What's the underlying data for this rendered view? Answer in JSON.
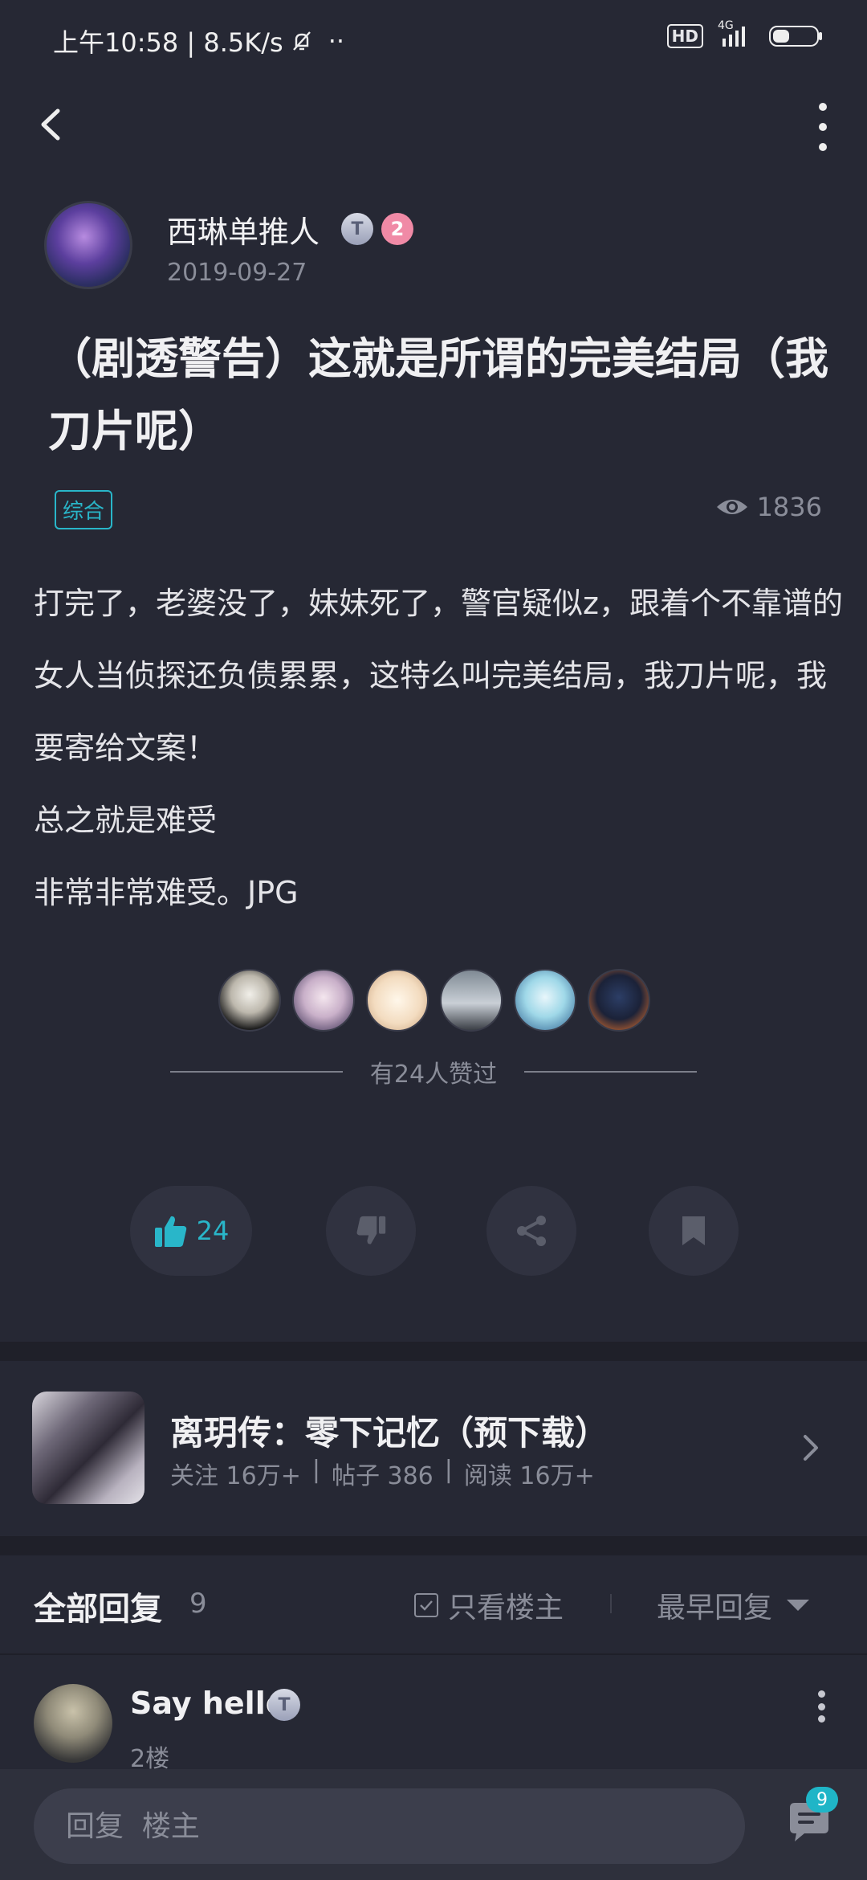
{
  "status_bar": {
    "time_speed": "上午10:58 | 8.5K/s",
    "dots": "··",
    "hd": "HD",
    "network": "4G"
  },
  "author": {
    "name": "西琳单推人",
    "badge_t": "T",
    "level": "2",
    "date": "2019-09-27"
  },
  "post": {
    "title": "（剧透警告）这就是所谓的完美结局（我刀片呢）",
    "tag": "综合",
    "views": "1836",
    "paragraphs": [
      "打完了，老婆没了，妹妹死了，警官疑似z，跟着个不靠谱的女人当侦探还负债累累，这特么叫完美结局，我刀片呢，我要寄给文案！",
      "总之就是难受",
      "非常非常难受。JPG"
    ],
    "liked_text": "有24人赞过"
  },
  "actions": {
    "like_count": "24"
  },
  "game": {
    "title": "离玥传：零下记忆（预下载）",
    "follow": "关注 16万+",
    "posts": "帖子 386",
    "reads": "阅读 16万+",
    "sep": "|"
  },
  "replies": {
    "title": "全部回复",
    "count": "9",
    "only_op": "只看楼主",
    "sort": "最早回复",
    "first": {
      "name": "Say hello",
      "badge_t": "T",
      "floor": "2楼"
    }
  },
  "bottom": {
    "placeholder": "回复  楼主",
    "comment_badge": "9"
  },
  "colors": {
    "background": "#262834",
    "accent": "#29b6c9",
    "muted": "#8a8d99"
  },
  "icons": [
    "back-icon",
    "more-icon",
    "eye-icon",
    "thumbs-up-icon",
    "thumbs-down-icon",
    "share-icon",
    "bookmark-icon",
    "chevron-right-icon",
    "checkbox-icon",
    "dropdown-triangle-icon",
    "comment-icon",
    "mute-bell-icon",
    "battery-icon",
    "signal-icon"
  ]
}
